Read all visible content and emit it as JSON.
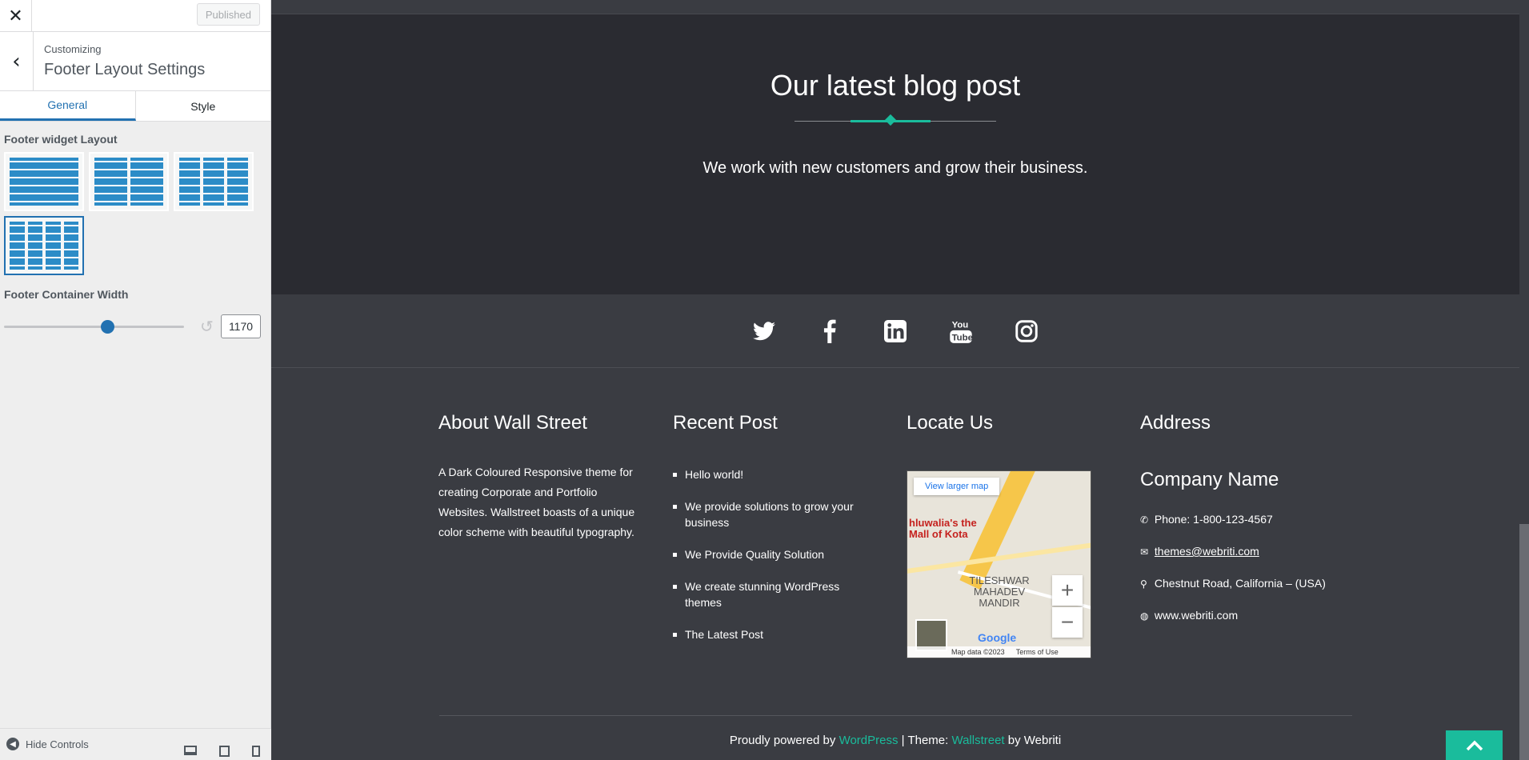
{
  "customizer": {
    "close_icon": "close-icon",
    "published_label": "Published",
    "breadcrumb": "Customizing",
    "title": "Footer Layout Settings",
    "tabs": [
      "General",
      "Style"
    ],
    "active_tab": "General",
    "widget_layout_label": "Footer widget Layout",
    "layout_options": [
      1,
      2,
      3,
      4
    ],
    "selected_layout": 4,
    "container_width_label": "Footer Container Width",
    "container_width_value": "1170",
    "container_width_fraction": 0.57,
    "hide_controls_label": "Hide Controls",
    "device_icons": [
      "desktop-icon",
      "tablet-icon",
      "mobile-icon"
    ]
  },
  "blog": {
    "title": "Our latest blog post",
    "subtitle": "We work with new customers and grow their business."
  },
  "social": [
    "twitter-icon",
    "facebook-icon",
    "linkedin-icon",
    "youtube-icon",
    "instagram-icon"
  ],
  "footer": {
    "about": {
      "heading": "About Wall Street",
      "text": "A Dark Coloured Responsive theme for creating Corporate and Portfolio Websites. Wallstreet boasts of a unique color scheme with beautiful typography."
    },
    "recent": {
      "heading": "Recent Post",
      "posts": [
        "Hello world!",
        "We provide solutions to grow your business",
        "We Provide Quality Solution",
        "We create stunning WordPress themes",
        "The Latest Post"
      ]
    },
    "locate": {
      "heading": "Locate Us",
      "map_button": "View larger map",
      "place": "hluwalia's the Mall of Kota",
      "area": "TILESHWAR MAHADEV MANDIR",
      "google": "Google",
      "map_data": "Map data ©2023",
      "terms": "Terms of Use"
    },
    "address": {
      "heading": "Address",
      "company": "Company Name",
      "phone": "Phone: 1-800-123-4567",
      "email": "themes@webriti.com",
      "location": "Chestnut Road, California – (USA)",
      "website": "www.webriti.com"
    },
    "copyright": {
      "prefix": "Proudly powered by ",
      "wordpress": "WordPress",
      "mid": " | Theme: ",
      "theme": "Wallstreet",
      "suffix": " by Webriti"
    }
  },
  "colors": {
    "accent": "#1abc9c",
    "wp_blue": "#2271b1",
    "bg_dark": "#2a2b31",
    "bg_footer": "#3a3c42"
  }
}
